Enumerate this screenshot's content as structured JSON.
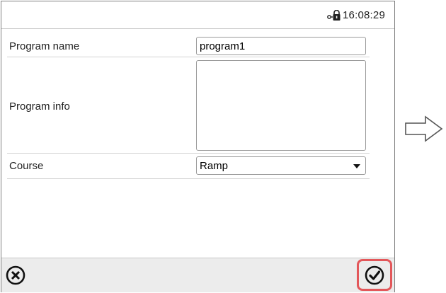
{
  "status_bar": {
    "lock_icon": "door-lock-icon",
    "time": "16:08:29"
  },
  "form": {
    "program_name": {
      "label": "Program name",
      "value": "program1"
    },
    "program_info": {
      "label": "Program info",
      "value": ""
    },
    "course": {
      "label": "Course",
      "value": "Ramp"
    }
  },
  "footer": {
    "cancel_icon": "cancel-x-circle-icon",
    "confirm_icon": "checkmark-circle-icon",
    "confirm_highlight_color": "#e3575a"
  },
  "colors": {
    "background": "#ffffff",
    "footer_background": "#ececec",
    "border": "#7f7f7f"
  }
}
